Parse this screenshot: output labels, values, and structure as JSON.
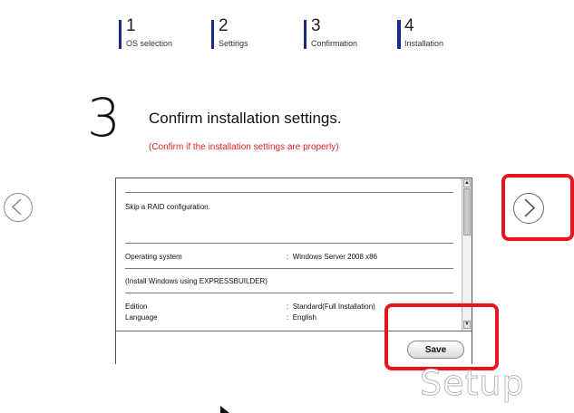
{
  "steps": [
    {
      "number": "1",
      "label": "OS selection"
    },
    {
      "number": "2",
      "label": "Settings"
    },
    {
      "number": "3",
      "label": "Confirmation"
    },
    {
      "number": "4",
      "label": "Installation"
    }
  ],
  "main": {
    "step_number": "3",
    "title": "Confirm installation settings.",
    "subtitle": "(Confirm if the installation settings are properly)"
  },
  "settings": {
    "raid": "Skip a RAID configuration.",
    "os_label": "Operating system",
    "os_value": "Windows Server 2008 x86",
    "install_note": "(Install Windows using EXPRESSBUILDER)",
    "edition_label": "Edition",
    "edition_value": "Standard(Full Installation)",
    "language_label": "Language",
    "language_value": "English",
    "separator": ":"
  },
  "buttons": {
    "save": "Save"
  },
  "icons": {
    "prev": "circle-chevron-left-icon",
    "next": "circle-chevron-right-icon",
    "scroll_up": "triangle-up-icon",
    "scroll_down": "triangle-down-icon"
  },
  "branding": {
    "watermark": "Setup"
  },
  "colors": {
    "accent": "#1a2a8a",
    "warning_text": "#e02020",
    "highlight": "#e8141b"
  }
}
